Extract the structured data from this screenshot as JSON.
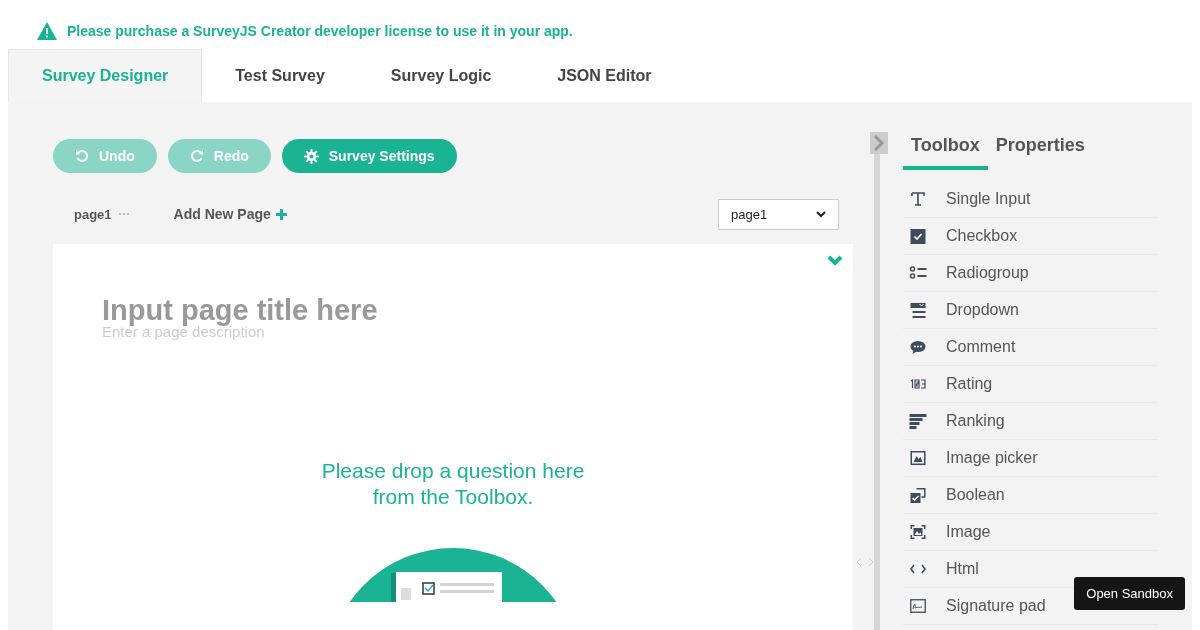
{
  "license_notice": "Please purchase a SurveyJS Creator developer license to use it in your app.",
  "tabs": [
    {
      "label": "Survey Designer",
      "selected": true
    },
    {
      "label": "Test Survey",
      "selected": false
    },
    {
      "label": "Survey Logic",
      "selected": false
    },
    {
      "label": "JSON Editor",
      "selected": false
    }
  ],
  "toolbar": [
    {
      "label": "Undo",
      "kind": "undo",
      "disabled": true
    },
    {
      "label": "Redo",
      "kind": "redo",
      "disabled": true
    },
    {
      "label": "Survey Settings",
      "kind": "settings",
      "disabled": false
    }
  ],
  "pages": {
    "current": "page1",
    "add_label": "Add New Page",
    "selector_value": "page1"
  },
  "page": {
    "title_placeholder": "Input page title here",
    "description_placeholder": "Enter a page description",
    "drop_hint": "Please drop a question here from the Toolbox."
  },
  "side_tabs": [
    {
      "label": "Toolbox",
      "selected": true
    },
    {
      "label": "Properties",
      "selected": false
    }
  ],
  "toolbox": [
    {
      "label": "Single Input",
      "kind": "text"
    },
    {
      "label": "Checkbox",
      "kind": "checkbox"
    },
    {
      "label": "Radiogroup",
      "kind": "radiogroup"
    },
    {
      "label": "Dropdown",
      "kind": "dropdown"
    },
    {
      "label": "Comment",
      "kind": "comment"
    },
    {
      "label": "Rating",
      "kind": "rating"
    },
    {
      "label": "Ranking",
      "kind": "ranking"
    },
    {
      "label": "Image picker",
      "kind": "imagepicker"
    },
    {
      "label": "Boolean",
      "kind": "boolean"
    },
    {
      "label": "Image",
      "kind": "image"
    },
    {
      "label": "Html",
      "kind": "html"
    },
    {
      "label": "Signature pad",
      "kind": "signature"
    }
  ],
  "sandbox_button": "Open Sandbox"
}
